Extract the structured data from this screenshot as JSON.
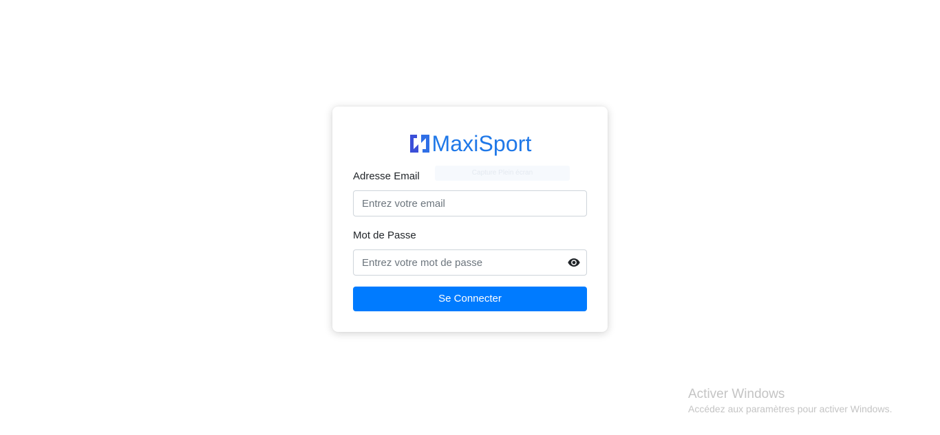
{
  "brand": {
    "name": "MaxiSport",
    "logo_icon": "maxisport-logo-icon",
    "color": "#1f78e8"
  },
  "overlay": {
    "ghost_tooltip_text": "Capture Plein écran"
  },
  "form": {
    "email": {
      "label": "Adresse Email",
      "placeholder": "Entrez votre email",
      "value": ""
    },
    "password": {
      "label": "Mot de Passe",
      "placeholder": "Entrez votre mot de passe",
      "value": "",
      "toggle_icon": "eye-icon"
    },
    "submit_label": "Se Connecter",
    "accent_color": "#007bff"
  },
  "watermark": {
    "title": "Activer Windows",
    "subtitle": "Accédez aux paramètres pour activer Windows."
  }
}
